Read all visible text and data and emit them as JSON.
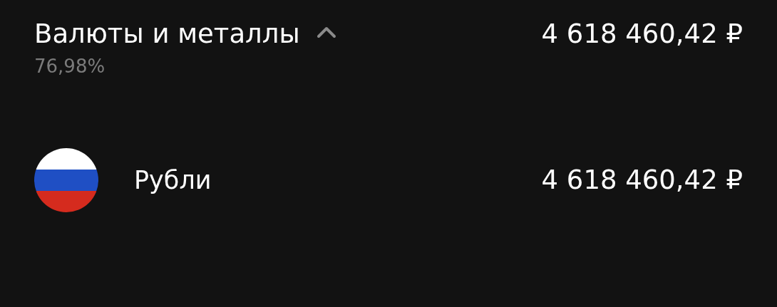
{
  "section": {
    "title": "Валюты и металлы",
    "expanded": true,
    "share": "76,98%",
    "total": "4 618 460,42 ₽"
  },
  "items": [
    {
      "name": "Рубли",
      "amount": "4 618 460,42 ₽",
      "kind": "flag"
    }
  ]
}
